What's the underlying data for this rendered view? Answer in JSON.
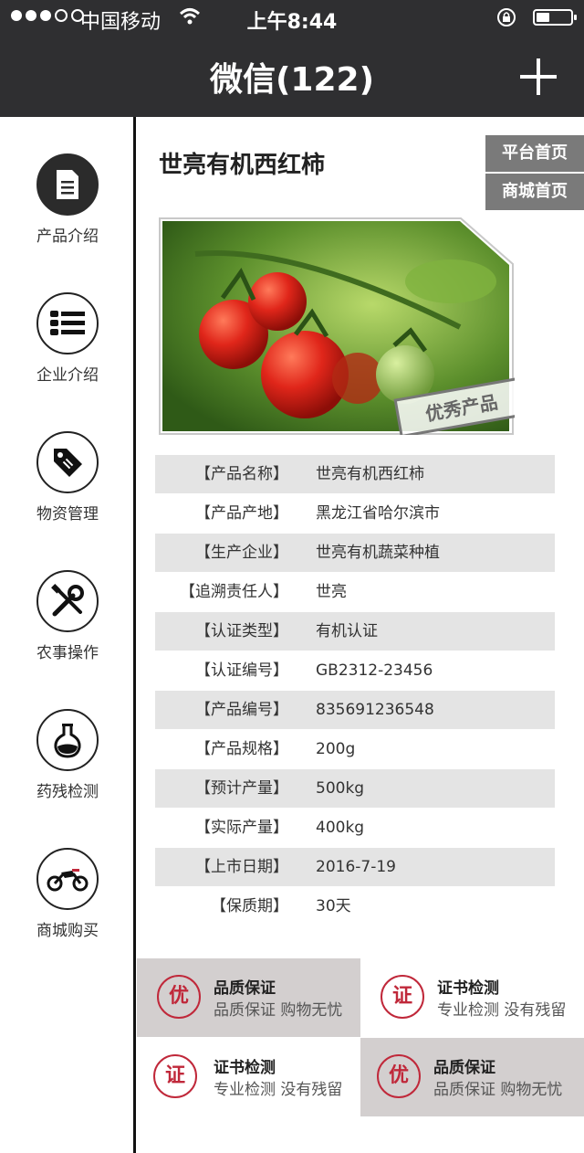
{
  "status": {
    "carrier": "中国移动",
    "time": "上午8:44"
  },
  "nav": {
    "title": "微信(122)"
  },
  "sidebar": {
    "items": [
      {
        "label": "产品介绍",
        "icon": "document-icon"
      },
      {
        "label": "企业介绍",
        "icon": "list-icon"
      },
      {
        "label": "物资管理",
        "icon": "tag-icon"
      },
      {
        "label": "农事操作",
        "icon": "tools-icon"
      },
      {
        "label": "药残检测",
        "icon": "flask-icon"
      },
      {
        "label": "商城购买",
        "icon": "motorcycle-icon"
      }
    ]
  },
  "main": {
    "title": "世亮有机西红柿",
    "platform_home": "平台首页",
    "mall_home": "商城首页",
    "stamp": "优秀产品"
  },
  "details": [
    {
      "label": "【产品名称】",
      "value": "世亮有机西红柿"
    },
    {
      "label": "【产品产地】",
      "value": "黑龙江省哈尔滨市"
    },
    {
      "label": "【生产企业】",
      "value": "世亮有机蔬菜种植"
    },
    {
      "label": "【追溯责任人】",
      "value": "世亮"
    },
    {
      "label": "【认证类型】",
      "value": "有机认证"
    },
    {
      "label": "【认证编号】",
      "value": "GB2312-23456"
    },
    {
      "label": "【产品编号】",
      "value": "835691236548"
    },
    {
      "label": "【产品规格】",
      "value": "200g"
    },
    {
      "label": "【预计产量】",
      "value": "500kg"
    },
    {
      "label": "【实际产量】",
      "value": "400kg"
    },
    {
      "label": "【上市日期】",
      "value": "2016-7-19"
    },
    {
      "label": "【保质期】",
      "value": "30天"
    }
  ],
  "features": [
    {
      "badge": "优",
      "title": "品质保证",
      "sub": "品质保证 购物无忧"
    },
    {
      "badge": "证",
      "title": "证书检测",
      "sub": "专业检测 没有残留"
    },
    {
      "badge": "证",
      "title": "证书检测",
      "sub": "专业检测 没有残留"
    },
    {
      "badge": "优",
      "title": "品质保证",
      "sub": "品质保证 购物无忧"
    }
  ],
  "colors": {
    "header": "#2f2f31",
    "accent_red": "#c0283a",
    "button_gray": "#7a7a7a",
    "row_gray": "#e4e4e4"
  }
}
